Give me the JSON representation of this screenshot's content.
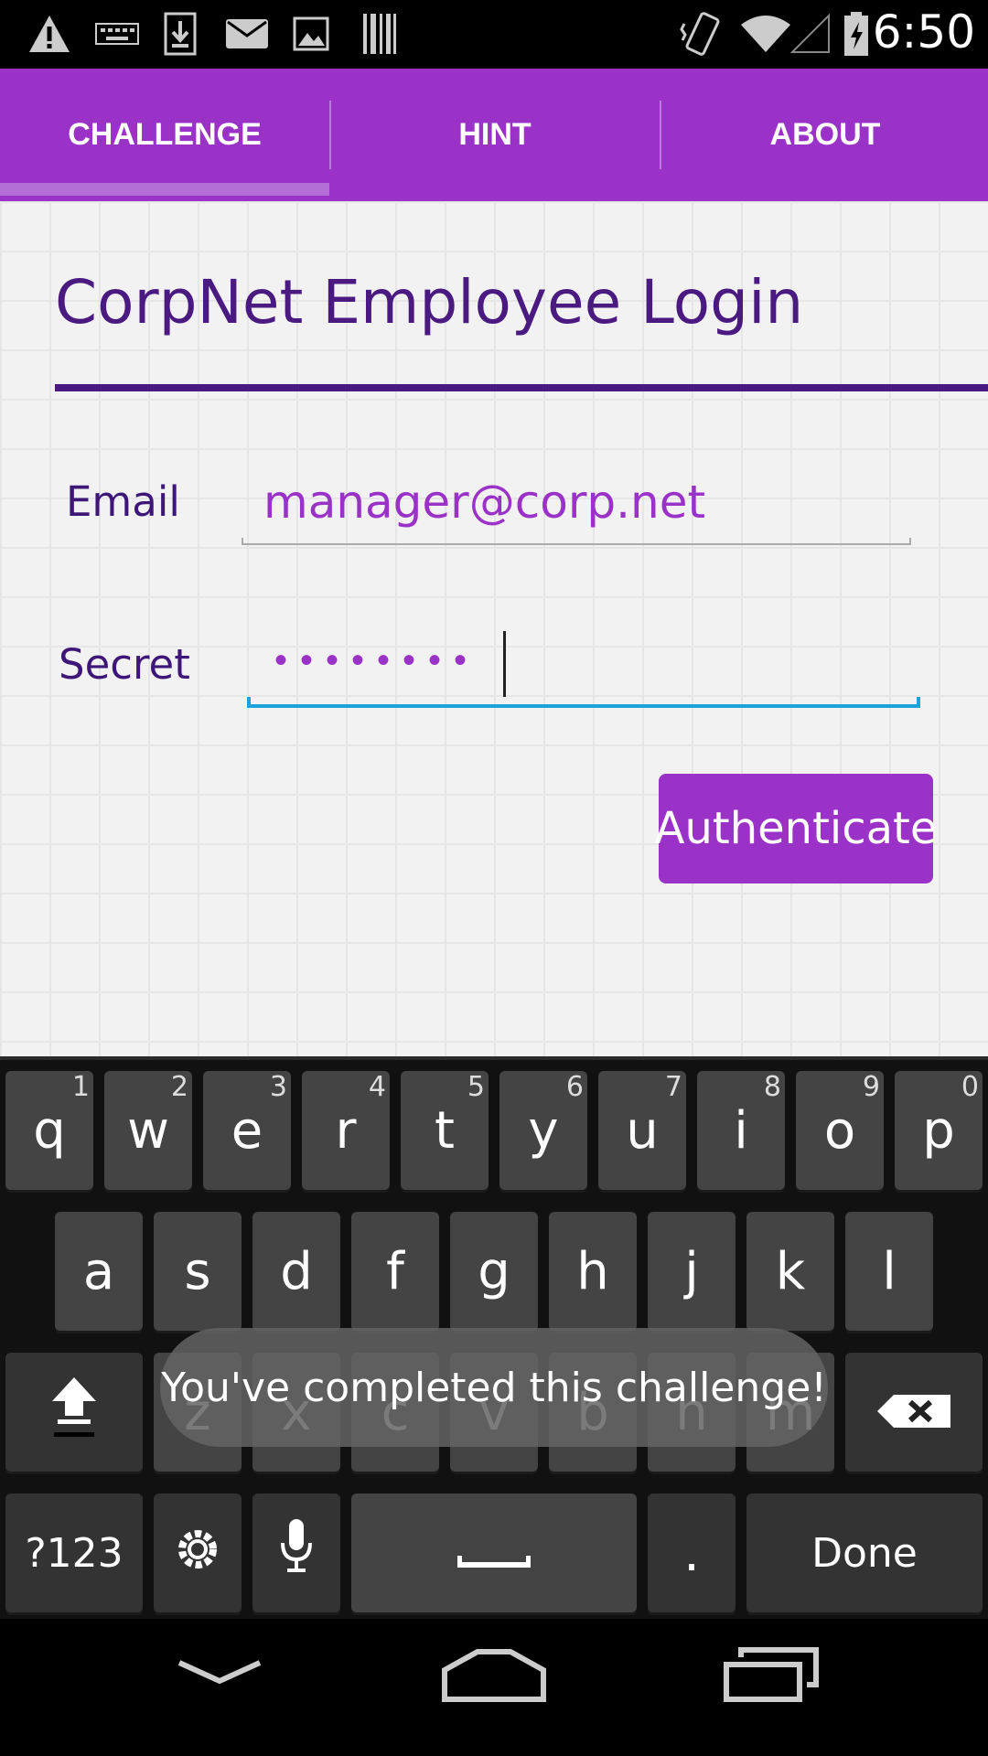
{
  "status_bar": {
    "time": "6:50",
    "icons": [
      "warning-icon",
      "keyboard-icon",
      "download-icon",
      "mail-icon",
      "image-icon",
      "barcode-icon",
      "vibrate-icon",
      "wifi-icon",
      "signal-icon",
      "battery-charging-icon"
    ]
  },
  "tabs": [
    {
      "label": "CHALLENGE",
      "selected": true
    },
    {
      "label": "HINT",
      "selected": false
    },
    {
      "label": "ABOUT",
      "selected": false
    }
  ],
  "form": {
    "title": "CorpNet Employee Login",
    "email_label": "Email",
    "email_value": "manager@corp.net",
    "secret_label": "Secret",
    "secret_value": "••••••••",
    "submit_label": "Authenticate"
  },
  "keyboard": {
    "row1": [
      {
        "k": "q",
        "h": "1"
      },
      {
        "k": "w",
        "h": "2"
      },
      {
        "k": "e",
        "h": "3"
      },
      {
        "k": "r",
        "h": "4"
      },
      {
        "k": "t",
        "h": "5"
      },
      {
        "k": "y",
        "h": "6"
      },
      {
        "k": "u",
        "h": "7"
      },
      {
        "k": "i",
        "h": "8"
      },
      {
        "k": "o",
        "h": "9"
      },
      {
        "k": "p",
        "h": "0"
      }
    ],
    "row2": [
      "a",
      "s",
      "d",
      "f",
      "g",
      "h",
      "j",
      "k",
      "l"
    ],
    "row3": [
      "z",
      "x",
      "c",
      "v",
      "b",
      "n",
      "m"
    ],
    "symbols_label": "?123",
    "period_label": ".",
    "done_label": "Done"
  },
  "toast": "You've completed this challenge!",
  "colors": {
    "accent": "#9a32c8",
    "title": "#4a1a80",
    "focus": "#1ea3d8"
  }
}
